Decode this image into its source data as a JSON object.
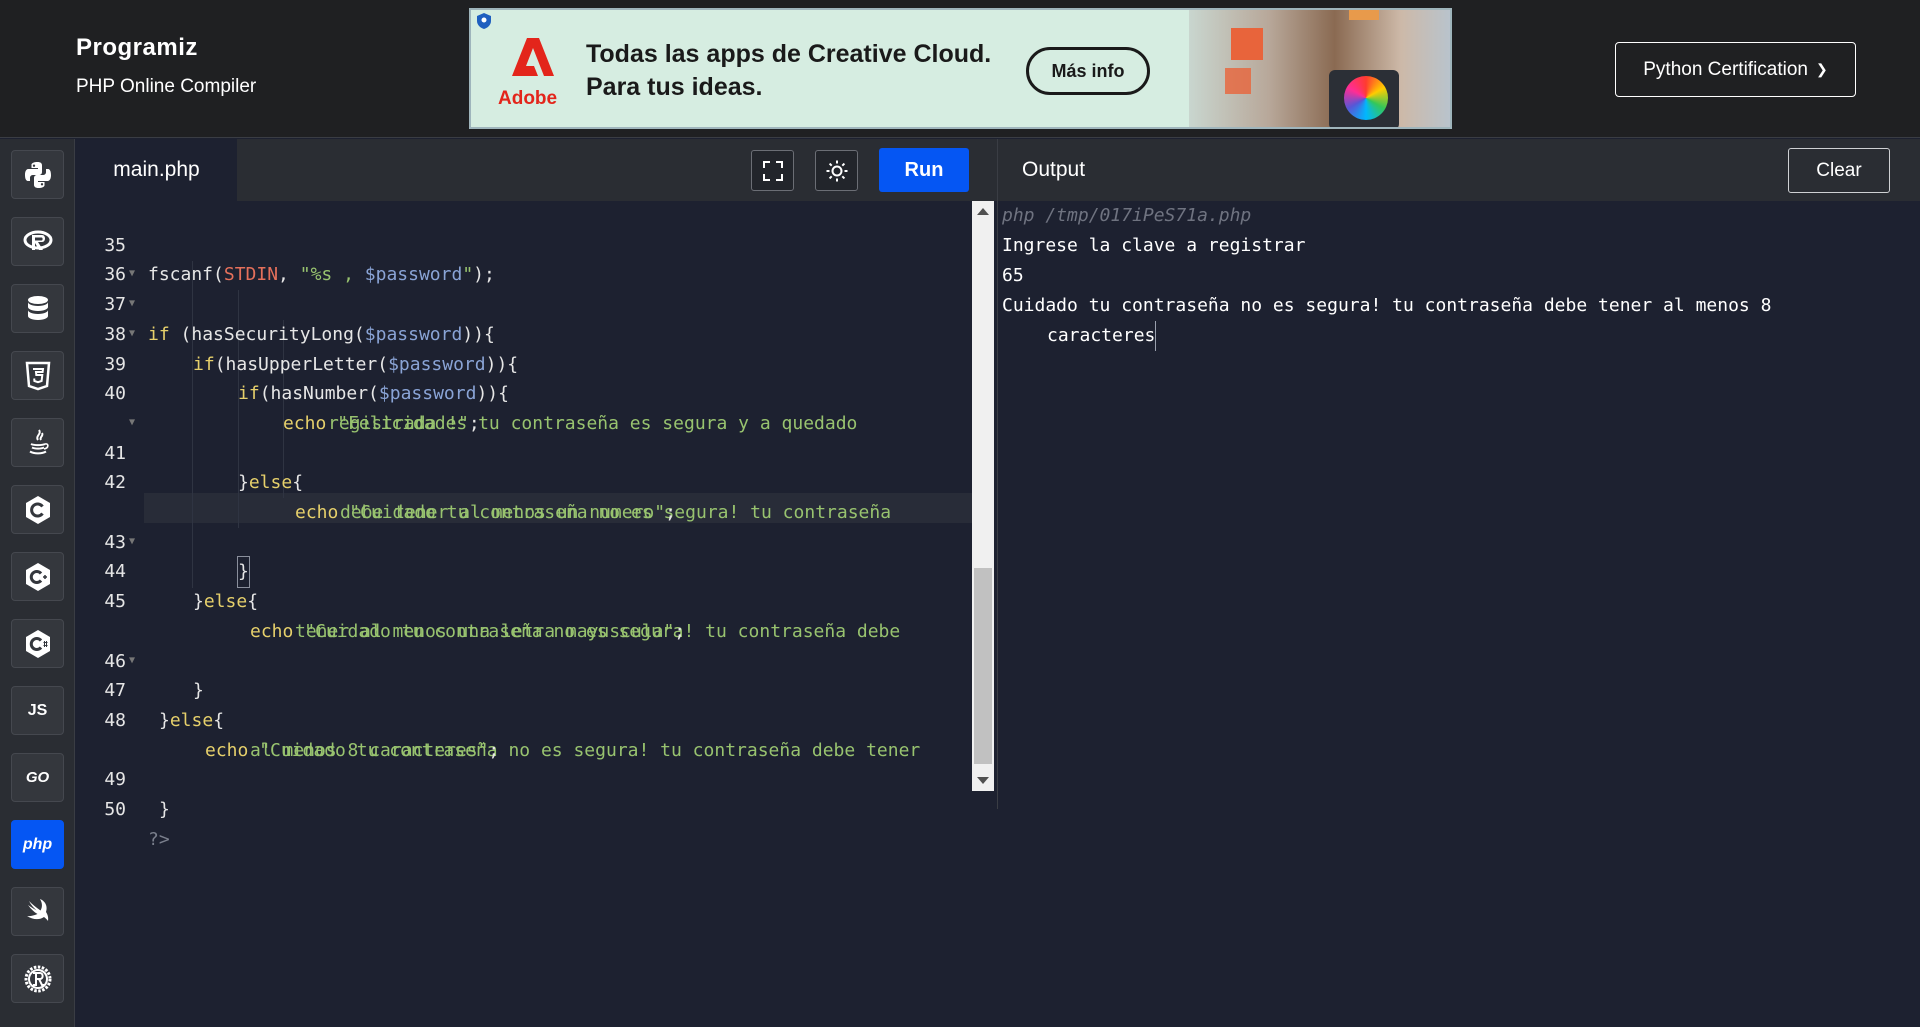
{
  "header": {
    "brand_name": "rogramiz",
    "brand_initial": "P",
    "subtitle": "PHP Online Compiler",
    "cert_button": "Python Certification",
    "cert_chevron": "❯"
  },
  "ad": {
    "brand": "Adobe",
    "line1": "Todas las apps de Creative Cloud.",
    "line2": "Para tus ideas.",
    "button": "Más info"
  },
  "sidebar": {
    "items": [
      {
        "name": "python",
        "icon": "python-icon"
      },
      {
        "name": "r",
        "icon": "r-icon"
      },
      {
        "name": "sql",
        "icon": "database-icon"
      },
      {
        "name": "html",
        "icon": "html5-icon"
      },
      {
        "name": "java",
        "icon": "java-icon"
      },
      {
        "name": "c",
        "icon": "c-icon"
      },
      {
        "name": "cpp",
        "icon": "cpp-icon"
      },
      {
        "name": "csharp",
        "icon": "csharp-icon"
      },
      {
        "name": "js",
        "label": "JS"
      },
      {
        "name": "go",
        "label": "GO"
      },
      {
        "name": "php",
        "label": "php",
        "active": true
      },
      {
        "name": "swift",
        "icon": "swift-icon"
      },
      {
        "name": "rust",
        "icon": "rust-icon"
      }
    ]
  },
  "editor": {
    "file_name": "main.php",
    "run_label": "Run",
    "lines": [
      {
        "n": "35",
        "text": "fscanf(STDIN, \"%s , $password\");"
      },
      {
        "n": "36",
        "text": ""
      },
      {
        "n": "37",
        "text": "if (hasSecurityLong($password)){"
      },
      {
        "n": "38",
        "text": "if(hasUpperLetter($password)){"
      },
      {
        "n": "39",
        "text": "if(hasNumber($password)){"
      },
      {
        "n": "40",
        "text": "echo \"Felicidades tu contraseña es segura y a quedado"
      },
      {
        "n": "",
        "text": "registrada !\";"
      },
      {
        "n": "41",
        "text": "}else{"
      },
      {
        "n": "42",
        "text": "echo \"Cuidado tu contraseña no es segura! tu contraseña"
      },
      {
        "n": "",
        "text": "debe tener al menos un numero\";"
      },
      {
        "n": "43",
        "text": "}"
      },
      {
        "n": "44",
        "text": "}else{"
      },
      {
        "n": "45",
        "text": "echo \"Cuidado tu contraseña no es segura! tu contraseña debe"
      },
      {
        "n": "",
        "text": "tener al menos una letra mayuscula\";"
      },
      {
        "n": "46",
        "text": "}"
      },
      {
        "n": "47",
        "text": "}else{"
      },
      {
        "n": "48",
        "text": "echo \"Cuidado tu contraseña no es segura! tu contraseña debe tener"
      },
      {
        "n": "",
        "text": "al menos 8 caracteres\";"
      },
      {
        "n": "49",
        "text": "}"
      },
      {
        "n": "50",
        "text": "?>"
      }
    ]
  },
  "output": {
    "title": "Output",
    "clear_label": "Clear",
    "lines": [
      "php /tmp/017iPeS71a.php",
      "Ingrese la clave a registrar",
      "65",
      "Cuidado tu contraseña no es segura! tu contraseña debe tener al menos 8",
      "caracteres"
    ]
  },
  "colors": {
    "accent": "#0556f3",
    "keyword": "#e6d06b",
    "string": "#98c36f",
    "variable": "#8aa4d6",
    "constant": "#e5705b"
  }
}
